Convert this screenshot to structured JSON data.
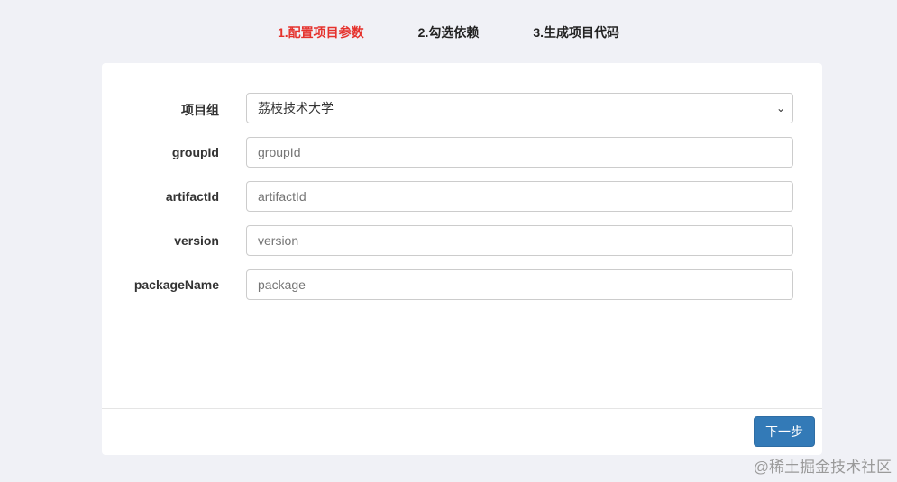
{
  "steps": [
    "1.配置项目参数",
    "2.勾选依赖",
    "3.生成项目代码"
  ],
  "active_step": 1,
  "form": {
    "group": {
      "label": "项目组",
      "value": "荔枝技术大学"
    },
    "groupId": {
      "label": "groupId",
      "placeholder": "groupId"
    },
    "artifactId": {
      "label": "artifactId",
      "placeholder": "artifactId"
    },
    "version": {
      "label": "version",
      "placeholder": "version"
    },
    "packageName": {
      "label": "packageName",
      "placeholder": "package"
    }
  },
  "next_button": "下一步",
  "watermark": "@稀土掘金技术社区"
}
